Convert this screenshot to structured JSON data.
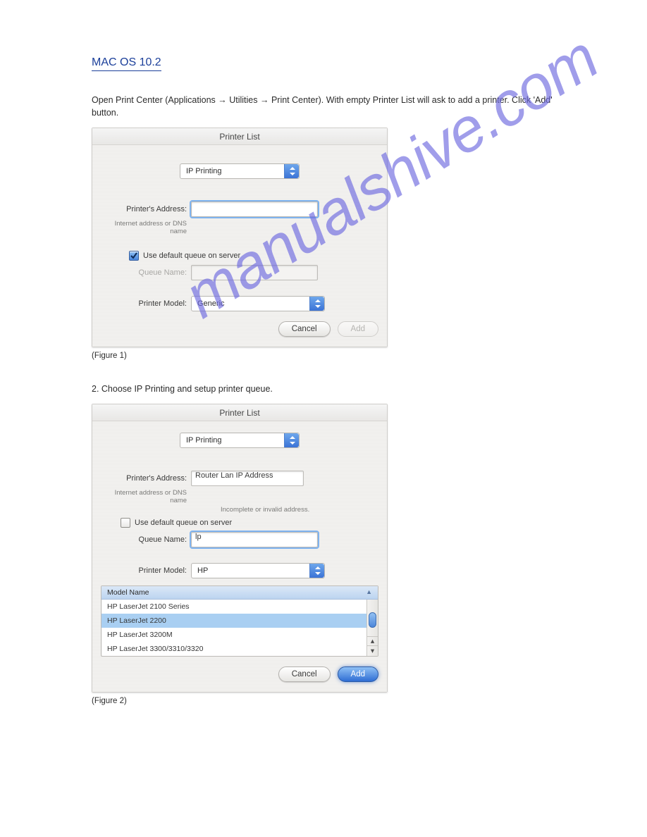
{
  "heading": "MAC OS 10.2",
  "intro": "Open Print Center (Applications → Utilities → Print Center). With empty Printer List will ask to add a printer. Click 'Add' button.",
  "figure1_label": "(Figure 1)",
  "step2": "2. Choose IP Printing and setup printer queue.",
  "figure2_label": "(Figure 2)",
  "watermark": "manualshive.com",
  "dlg1": {
    "title": "Printer List",
    "protocol_value": "IP Printing",
    "address_label": "Printer's Address:",
    "address_hint": "Internet address or DNS name",
    "address_value": "",
    "default_queue_checked": true,
    "default_queue_label": "Use default queue on server",
    "queue_name_label": "Queue Name:",
    "queue_name_value": "",
    "printer_model_label": "Printer Model:",
    "printer_model_value": "Generic",
    "cancel": "Cancel",
    "add": "Add"
  },
  "dlg2": {
    "title": "Printer List",
    "protocol_value": "IP Printing",
    "address_label": "Printer's Address:",
    "address_hint": "Internet address or DNS name",
    "address_value": "Router Lan IP Address",
    "invalid_hint": "Incomplete or invalid address.",
    "default_queue_checked": false,
    "default_queue_label": "Use default queue on server",
    "queue_name_label": "Queue Name:",
    "queue_name_value": "lp",
    "printer_model_label": "Printer Model:",
    "printer_model_value": "HP",
    "model_header": "Model Name",
    "models": [
      "HP LaserJet 2100 Series",
      "HP LaserJet 2200",
      "HP LaserJet 3200M",
      "HP LaserJet 3300/3310/3320"
    ],
    "selected_model_index": 1,
    "cancel": "Cancel",
    "add": "Add"
  }
}
